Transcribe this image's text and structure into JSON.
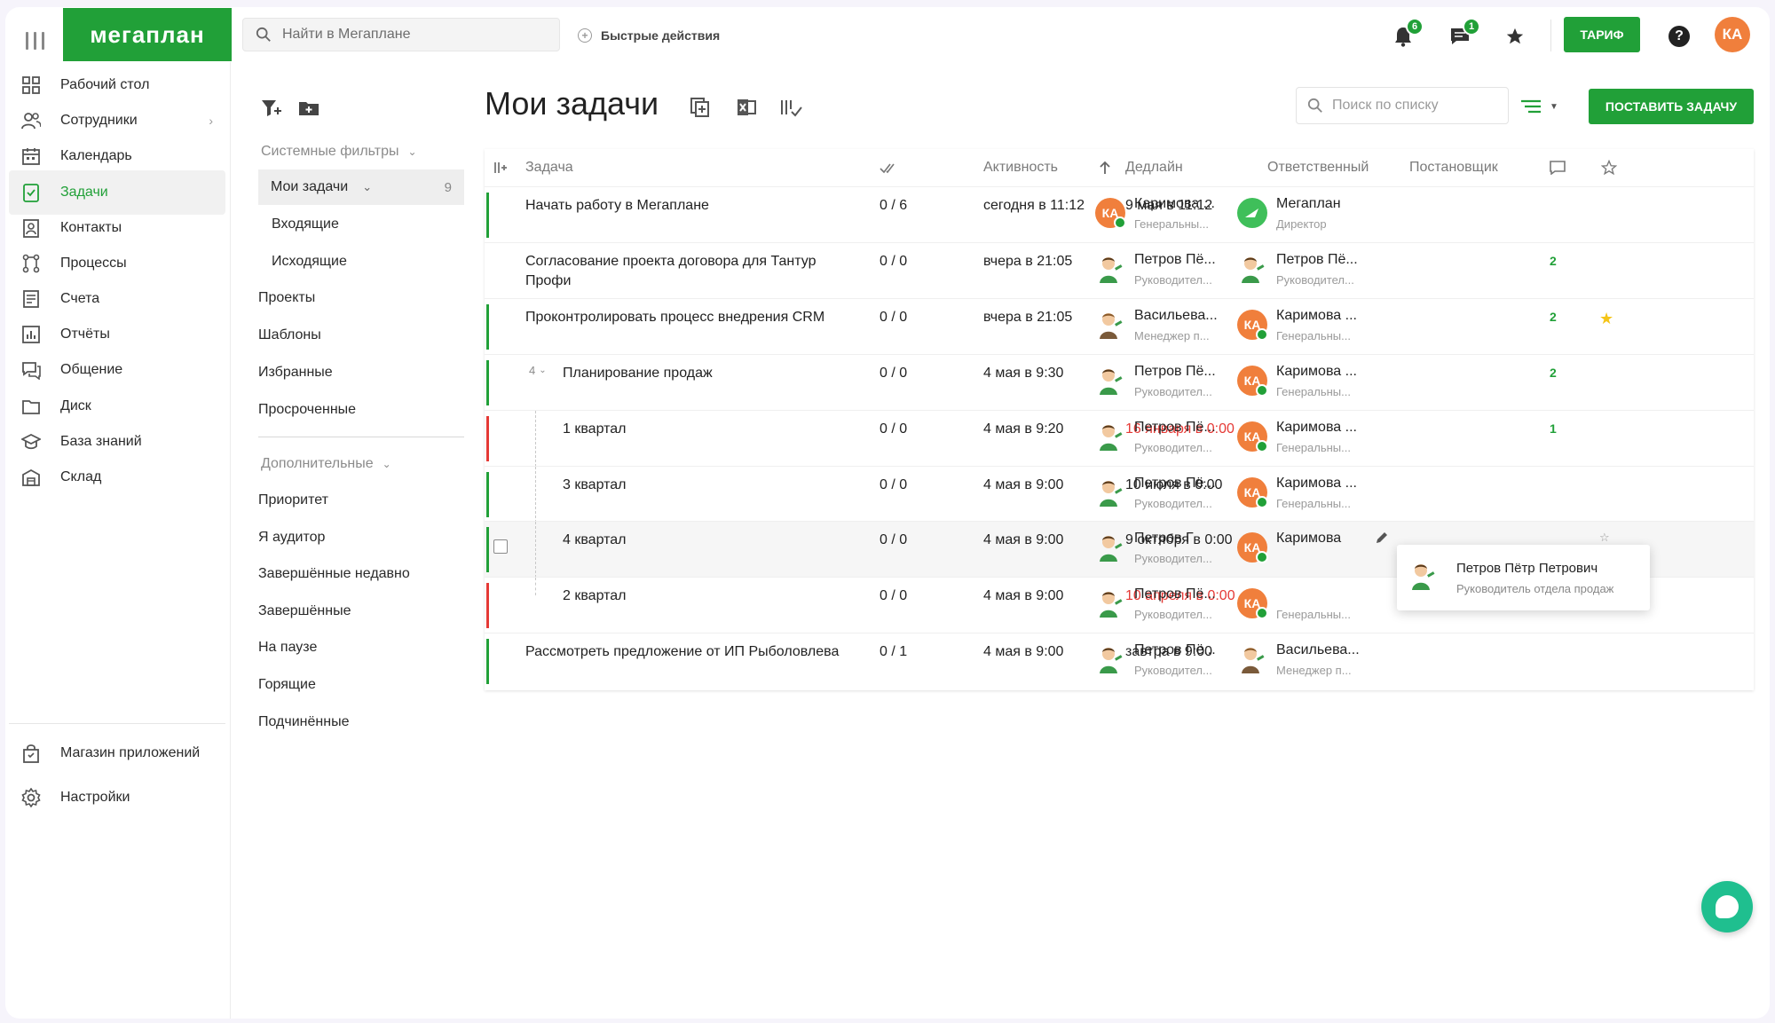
{
  "header": {
    "logo": "мегаплан",
    "search_placeholder": "Найти в Мегаплане",
    "quick_actions": "Быстрые действия",
    "notifications_count": "6",
    "messages_count": "1",
    "tarif": "ТАРИФ",
    "help": "?",
    "user_initials": "КА",
    "accent_color": "#21a038"
  },
  "nav": {
    "items": [
      {
        "label": "Рабочий стол",
        "icon": "grid-icon"
      },
      {
        "label": "Сотрудники",
        "icon": "users-icon"
      },
      {
        "label": "Календарь",
        "icon": "calendar-icon"
      },
      {
        "label": "Задачи",
        "icon": "tasks-icon"
      },
      {
        "label": "Контакты",
        "icon": "contacts-icon"
      },
      {
        "label": "Процессы",
        "icon": "processes-icon"
      },
      {
        "label": "Счета",
        "icon": "invoices-icon"
      },
      {
        "label": "Отчёты",
        "icon": "reports-icon"
      },
      {
        "label": "Общение",
        "icon": "chat-icon"
      },
      {
        "label": "Диск",
        "icon": "folder-icon"
      },
      {
        "label": "База знаний",
        "icon": "graduation-icon"
      },
      {
        "label": "Склад",
        "icon": "warehouse-icon"
      }
    ],
    "bottom": [
      {
        "label": "Магазин приложений",
        "icon": "shop-bag-icon"
      },
      {
        "label": "Настройки",
        "icon": "gear-icon"
      }
    ]
  },
  "filters": {
    "system_group": "Системные фильтры",
    "my_tasks": "Мои задачи",
    "my_tasks_count": "9",
    "incoming": "Входящие",
    "outgoing": "Исходящие",
    "system_items": [
      "Проекты",
      "Шаблоны",
      "Избранные",
      "Просроченные"
    ],
    "extra_group": "Дополнительные",
    "extra_items": [
      "Приоритет",
      "Я аудитор",
      "Завершённые недавно",
      "Завершённые",
      "На паузе",
      "Горящие",
      "Подчинённые"
    ]
  },
  "main": {
    "title": "Мои задачи",
    "list_search_placeholder": "Поиск по списку",
    "add_task": "ПОСТАВИТЬ ЗАДАЧУ",
    "columns": {
      "task": "Задача",
      "activity": "Активность",
      "deadline": "Дедлайн",
      "responsible": "Ответственный",
      "author": "Постановщик"
    },
    "rows": [
      {
        "name": "Начать работу в Мегаплане",
        "checks": "0 / 6",
        "activity": "сегодня в 11:12",
        "deadline": "9 мая в 11:12",
        "deadline_red": false,
        "stripe": "#21a038",
        "resp": {
          "name": "Каримова ...",
          "role": "Генеральны...",
          "av": "ka"
        },
        "author": {
          "name": "Мегаплан",
          "role": "Директор",
          "av": "mp"
        },
        "comments": "",
        "star": false
      },
      {
        "name": "Согласование проекта договора для Тантур Профи",
        "checks": "0 / 0",
        "activity": "вчера в 21:05",
        "deadline": "",
        "deadline_red": false,
        "stripe": "",
        "resp": {
          "name": "Петров Пё...",
          "role": "Руководител...",
          "av": "cartoon"
        },
        "author": {
          "name": "Петров Пё...",
          "role": "Руководител...",
          "av": "cartoon"
        },
        "comments": "2",
        "star": false
      },
      {
        "name": "Проконтролировать процесс внедрения CRM",
        "checks": "0 / 0",
        "activity": "вчера в 21:05",
        "deadline": "",
        "deadline_red": false,
        "stripe": "#21a038",
        "resp": {
          "name": "Васильева...",
          "role": "Менеджер п...",
          "av": "cartoon2"
        },
        "author": {
          "name": "Каримова ...",
          "role": "Генеральны...",
          "av": "ka"
        },
        "comments": "2",
        "star": true
      },
      {
        "name": "Планирование продаж",
        "checks": "0 / 0",
        "activity": "4 мая в 9:30",
        "deadline": "",
        "deadline_red": false,
        "stripe": "#21a038",
        "subcount": "4",
        "resp": {
          "name": "Петров Пё...",
          "role": "Руководител...",
          "av": "cartoon"
        },
        "author": {
          "name": "Каримова ...",
          "role": "Генеральны...",
          "av": "ka"
        },
        "comments": "2",
        "star": false
      },
      {
        "name": "1 квартал",
        "checks": "0 / 0",
        "activity": "4 мая в 9:20",
        "deadline": "16 января в 0:00",
        "deadline_red": true,
        "stripe": "#e53935",
        "sub": true,
        "resp": {
          "name": "Петров Пё...",
          "role": "Руководител...",
          "av": "cartoon"
        },
        "author": {
          "name": "Каримова ...",
          "role": "Генеральны...",
          "av": "ka"
        },
        "comments": "1",
        "star": false
      },
      {
        "name": "3 квартал",
        "checks": "0 / 0",
        "activity": "4 мая в 9:00",
        "deadline": "10 июля в 0:00",
        "deadline_red": false,
        "stripe": "#21a038",
        "sub": true,
        "resp": {
          "name": "Петров Пё...",
          "role": "Руководител...",
          "av": "cartoon"
        },
        "author": {
          "name": "Каримова ...",
          "role": "Генеральны...",
          "av": "ka"
        },
        "comments": "",
        "star": false
      },
      {
        "name": "4 квартал",
        "checks": "0 / 0",
        "activity": "4 мая в 9:00",
        "deadline": "9 октября в 0:00",
        "deadline_red": false,
        "stripe": "#21a038",
        "sub": true,
        "hover": true,
        "resp": {
          "name": "Петров Г",
          "role": "Руководител...",
          "av": "cartoon"
        },
        "author": {
          "name": "Каримова",
          "role": "",
          "av": "ka"
        },
        "comments": "",
        "star": false
      },
      {
        "name": "2 квартал",
        "checks": "0 / 0",
        "activity": "4 мая в 9:00",
        "deadline": "10 апреля в 0:00",
        "deadline_red": true,
        "stripe": "#e53935",
        "sub": true,
        "resp": {
          "name": "Петров Пё...",
          "role": "Руководител...",
          "av": "cartoon"
        },
        "author": {
          "name": "",
          "role": "Генеральны...",
          "av": "ka"
        },
        "comments": "",
        "star": false
      },
      {
        "name": "Рассмотреть предложение от ИП Рыболовлева",
        "checks": "0 / 1",
        "activity": "4 мая в 9:00",
        "deadline": "завтра в 9:00",
        "deadline_red": false,
        "stripe": "#21a038",
        "resp": {
          "name": "Петров Пё...",
          "role": "Руководител...",
          "av": "cartoon"
        },
        "author": {
          "name": "Васильева...",
          "role": "Менеджер п...",
          "av": "cartoon2"
        },
        "comments": "",
        "star": false
      }
    ],
    "tooltip": {
      "name": "Петров Пётр Петрович",
      "role": "Руководитель отдела продаж"
    }
  }
}
